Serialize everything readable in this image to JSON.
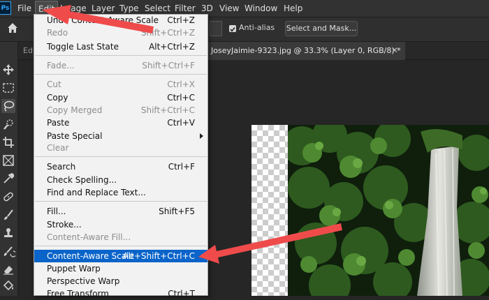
{
  "app": {
    "logo": "Ps"
  },
  "menubar": {
    "items": [
      "File",
      "Edit",
      "Image",
      "Layer",
      "Type",
      "Select",
      "Filter",
      "3D",
      "View",
      "Window",
      "Help"
    ]
  },
  "options": {
    "antialias_label": "Anti-alias",
    "select_mask_label": "Select and Mask..."
  },
  "tabs": {
    "left_label": "Ed",
    "active_title": "JoseyJaimie-9323.jpg @ 33.3% (Layer 0, RGB/8) *",
    "close_glyph": "✕"
  },
  "edit_menu": {
    "items": [
      {
        "label": "Undo Content-Aware Scale",
        "shortcut": "Ctrl+Z",
        "disabled": false
      },
      {
        "label": "Redo",
        "shortcut": "Shift+Ctrl+Z",
        "disabled": true
      },
      {
        "label": "Toggle Last State",
        "shortcut": "Alt+Ctrl+Z",
        "disabled": false
      },
      {
        "label": "Fade...",
        "shortcut": "Shift+Ctrl+F",
        "disabled": true
      },
      {
        "label": "Cut",
        "shortcut": "Ctrl+X",
        "disabled": true
      },
      {
        "label": "Copy",
        "shortcut": "Ctrl+C",
        "disabled": false
      },
      {
        "label": "Copy Merged",
        "shortcut": "Shift+Ctrl+C",
        "disabled": true
      },
      {
        "label": "Paste",
        "shortcut": "Ctrl+V",
        "disabled": false
      },
      {
        "label": "Paste Special",
        "shortcut": "",
        "disabled": false
      },
      {
        "label": "Clear",
        "shortcut": "",
        "disabled": true
      },
      {
        "label": "Search",
        "shortcut": "Ctrl+F",
        "disabled": false
      },
      {
        "label": "Check Spelling...",
        "shortcut": "",
        "disabled": false
      },
      {
        "label": "Find and Replace Text...",
        "shortcut": "",
        "disabled": false
      },
      {
        "label": "Fill...",
        "shortcut": "Shift+F5",
        "disabled": false
      },
      {
        "label": "Stroke...",
        "shortcut": "",
        "disabled": false
      },
      {
        "label": "Content-Aware Fill...",
        "shortcut": "",
        "disabled": true
      },
      {
        "label": "Content-Aware Scale",
        "shortcut": "Alt+Shift+Ctrl+C",
        "disabled": false
      },
      {
        "label": "Puppet Warp",
        "shortcut": "",
        "disabled": false
      },
      {
        "label": "Perspective Warp",
        "shortcut": "",
        "disabled": false
      },
      {
        "label": "Free Transform",
        "shortcut": "Ctrl+T",
        "disabled": false
      }
    ]
  },
  "colors": {
    "highlight": "#0a64c9",
    "arrow": "#ef4b4b",
    "menubar": "#323232"
  },
  "icons": [
    "home-icon",
    "move-icon",
    "marquee-icon",
    "lasso-icon",
    "quick-select-icon",
    "crop-icon",
    "frame-icon",
    "eyedropper-icon",
    "healing-icon",
    "brush-icon",
    "stamp-icon",
    "history-brush-icon",
    "eraser-icon",
    "paint-bucket-icon"
  ]
}
